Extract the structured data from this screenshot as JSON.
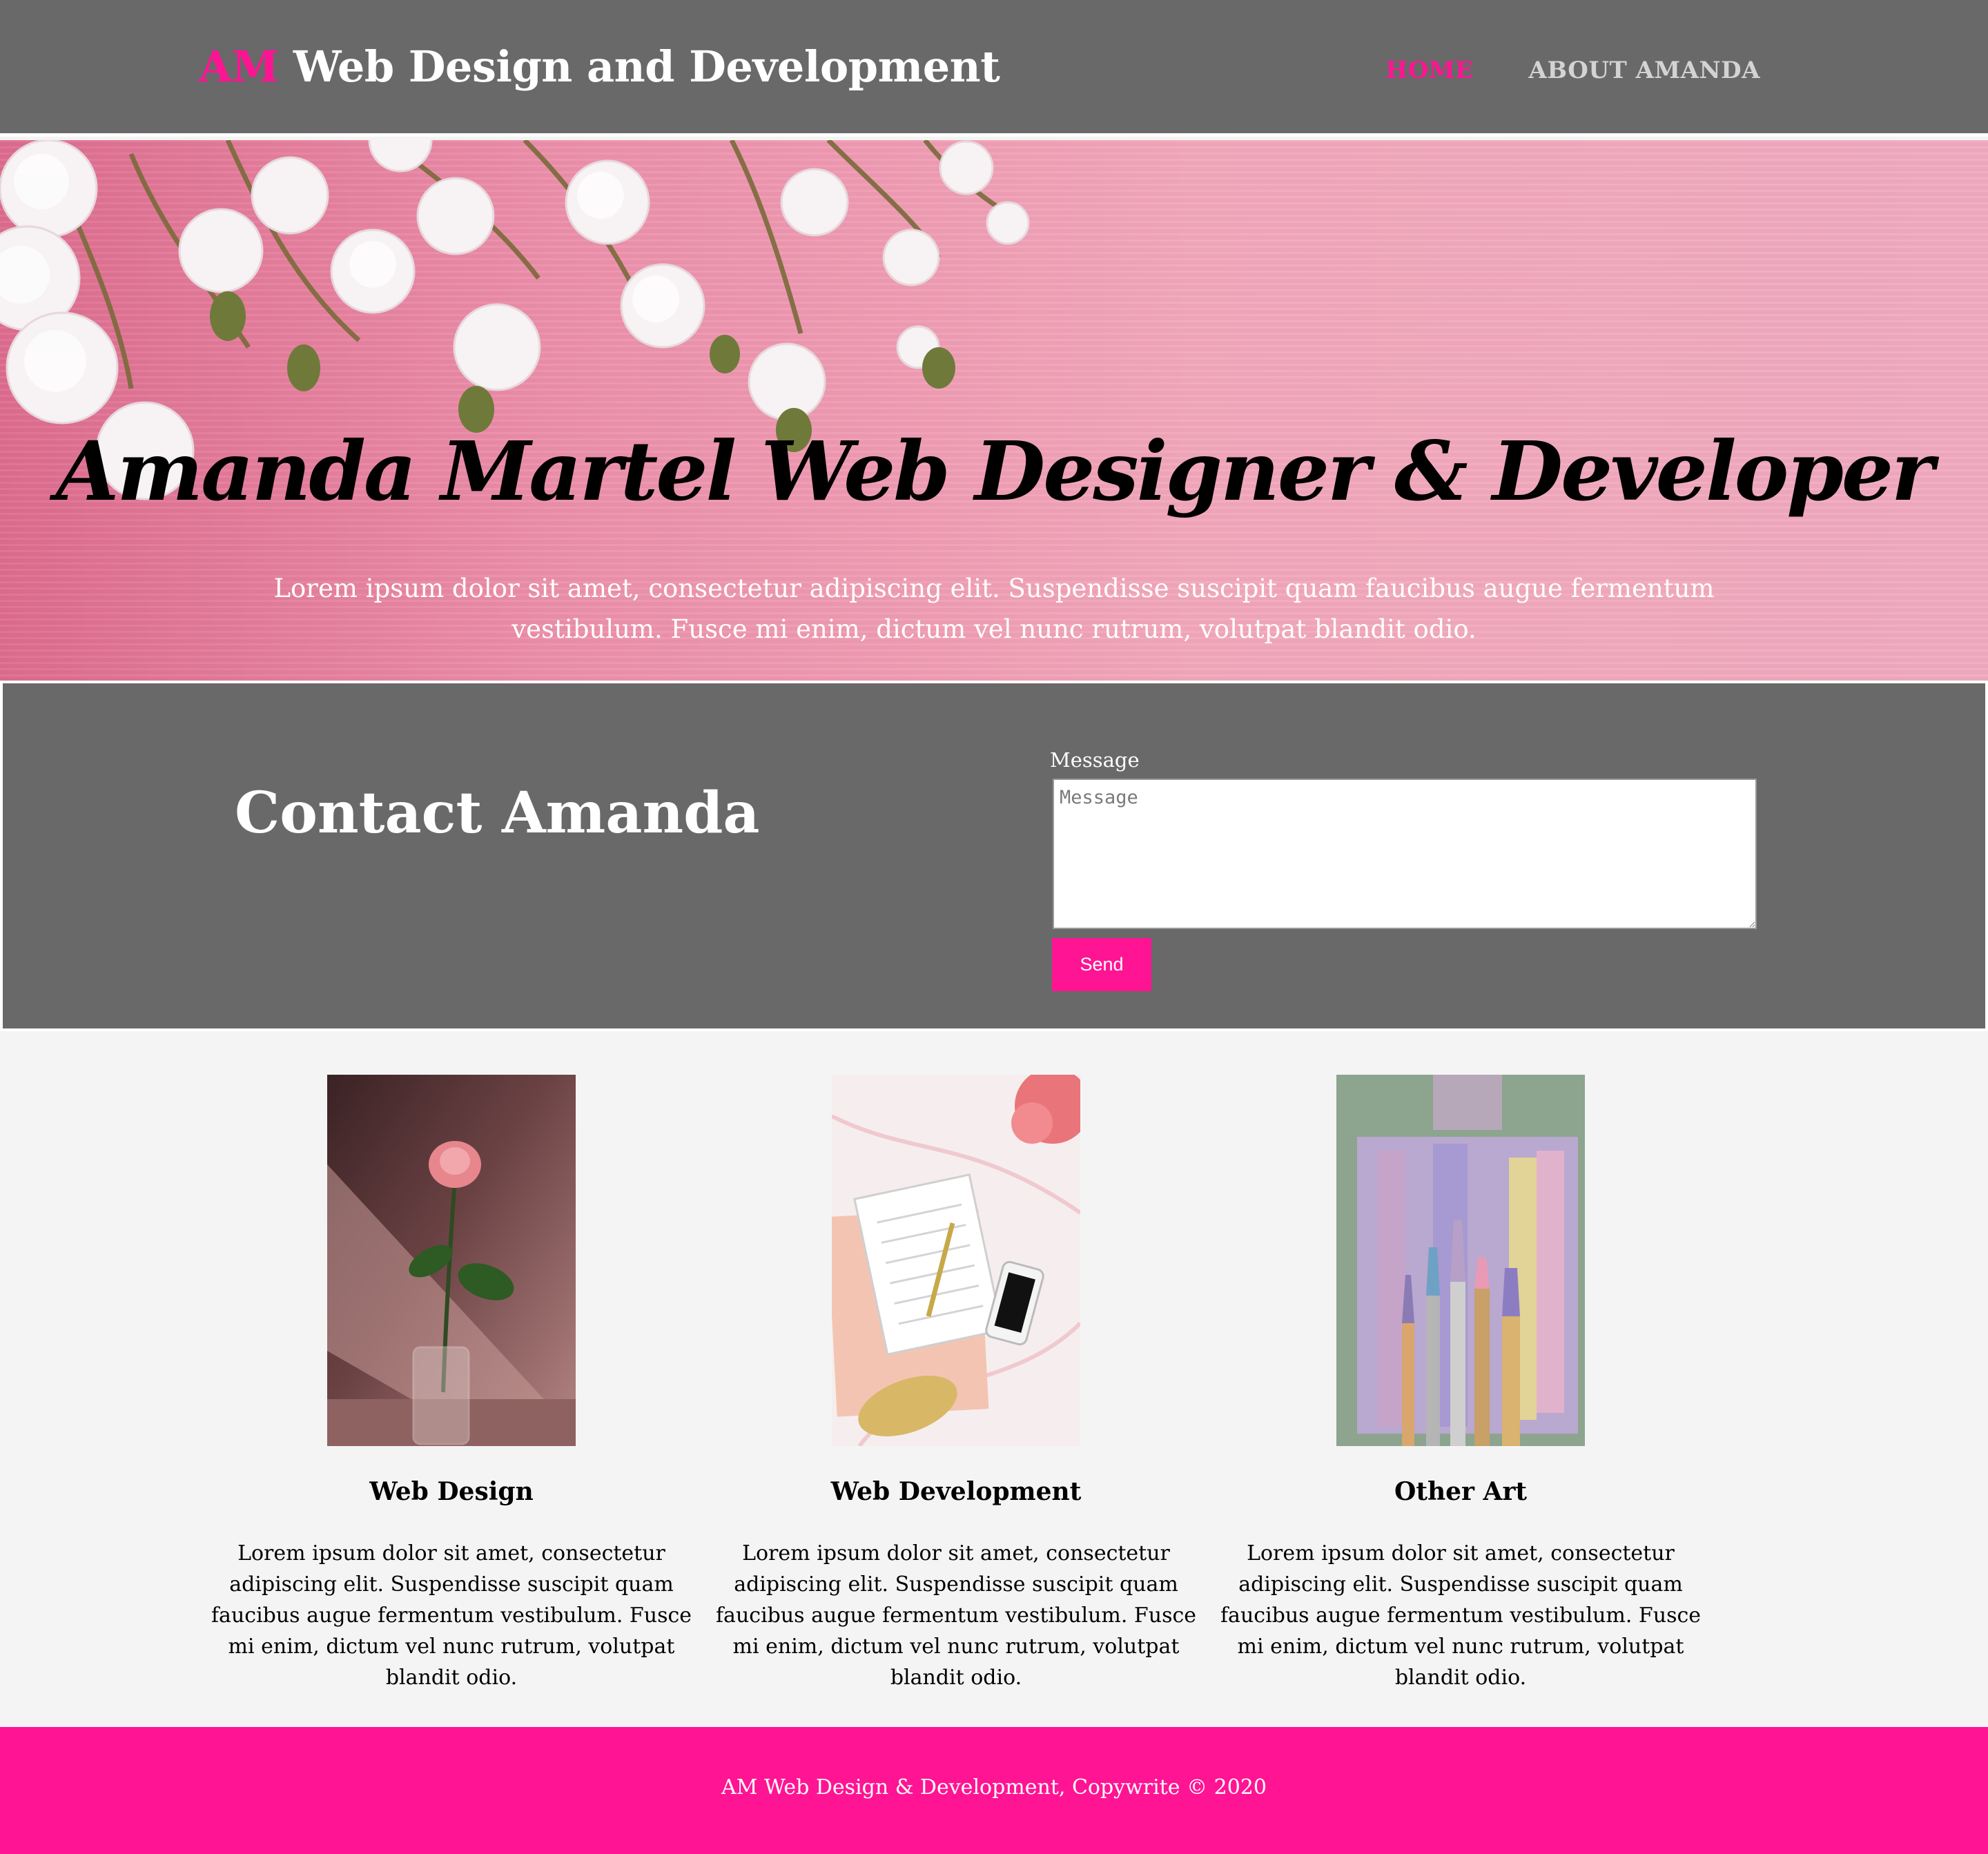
{
  "header": {
    "brand_accent": "AM",
    "brand_rest": " Web Design and Development",
    "nav": [
      {
        "label": "HOME",
        "active": true
      },
      {
        "label": "ABOUT AMANDA",
        "active": false
      }
    ]
  },
  "hero": {
    "title": "Amanda Martel Web Designer & Developer",
    "text": "Lorem ipsum dolor sit amet, consectetur adipiscing elit. Suspendisse suscipit quam faucibus augue fermentum vestibulum. Fusce mi enim, dictum vel nunc rutrum, volutpat blandit odio."
  },
  "contact": {
    "title": "Contact Amanda",
    "message_label": "Message",
    "message_placeholder": "Message",
    "message_value": "",
    "send_label": "Send"
  },
  "services": [
    {
      "title": "Web Design",
      "text": "Lorem ipsum dolor sit amet, consectetur adipiscing elit. Suspendisse suscipit quam faucibus augue fermentum vestibulum. Fusce mi enim, dictum vel nunc rutrum, volutpat blandit odio."
    },
    {
      "title": "Web Development",
      "text": "Lorem ipsum dolor sit amet, consectetur adipiscing elit. Suspendisse suscipit quam faucibus augue fermentum vestibulum. Fusce mi enim, dictum vel nunc rutrum, volutpat blandit odio."
    },
    {
      "title": "Other Art",
      "text": "Lorem ipsum dolor sit amet, consectetur adipiscing elit. Suspendisse suscipit quam faucibus augue fermentum vestibulum. Fusce mi enim, dictum vel nunc rutrum, volutpat blandit odio."
    }
  ],
  "footer": {
    "text": "AM Web Design & Development, Copywrite © 2020"
  },
  "colors": {
    "accent": "#ff1493",
    "header_bg": "#696969",
    "page_bg": "#f4f4f4"
  }
}
